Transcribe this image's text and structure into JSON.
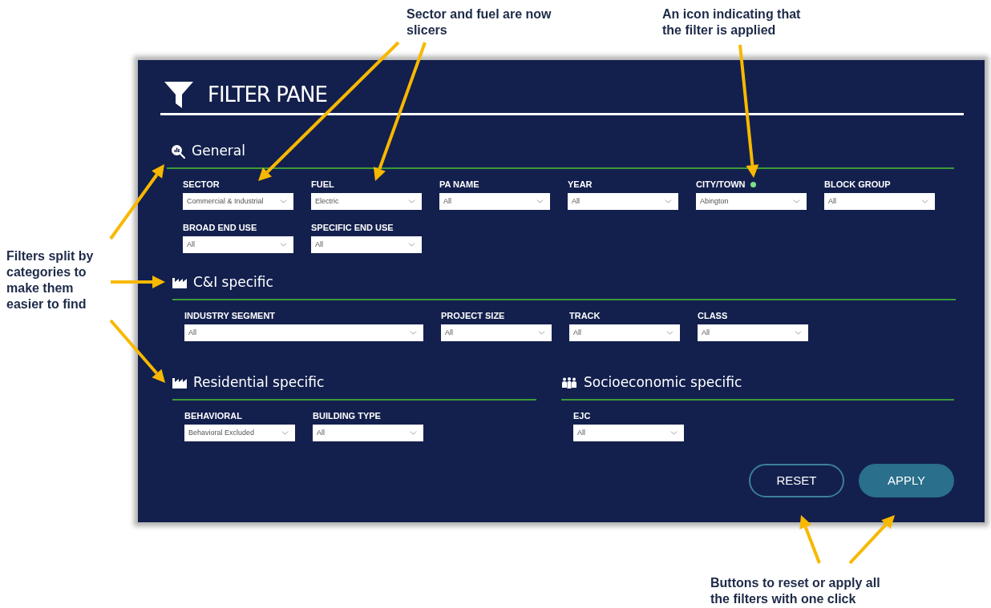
{
  "callouts": [
    {
      "text": "Sector and fuel are now slicers"
    },
    {
      "text": "An icon indicating that the filter is applied"
    },
    {
      "text": "Filters split by categories to make them easier to find"
    },
    {
      "text": "Buttons to reset or apply all the filters with one click"
    }
  ],
  "pane": {
    "title": "FILTER PANE",
    "sections": [
      {
        "title": "General",
        "filters": [
          {
            "label": "SECTOR",
            "value": "Commercial & Industrial",
            "applied": false,
            "wide": false
          },
          {
            "label": "FUEL",
            "value": "Electric",
            "applied": false,
            "wide": false
          },
          {
            "label": "PA NAME",
            "value": "All",
            "applied": false,
            "wide": false
          },
          {
            "label": "YEAR",
            "value": "All",
            "applied": false,
            "wide": false
          },
          {
            "label": "CITY/TOWN",
            "value": "Abington",
            "applied": true,
            "wide": false
          },
          {
            "label": "BLOCK GROUP",
            "value": "All",
            "applied": false,
            "wide": false
          },
          {
            "label": "BROAD END USE",
            "value": "All",
            "applied": false,
            "wide": false
          },
          {
            "label": "SPECIFIC END USE",
            "value": "All",
            "applied": false,
            "wide": false
          }
        ]
      },
      {
        "title": "C&I specific",
        "filters": [
          {
            "label": "INDUSTRY SEGMENT",
            "value": "All",
            "applied": false,
            "wide": true
          },
          {
            "label": "PROJECT SIZE",
            "value": "All",
            "applied": false,
            "wide": false
          },
          {
            "label": "TRACK",
            "value": "All",
            "applied": false,
            "wide": false
          },
          {
            "label": "CLASS",
            "value": "All",
            "applied": false,
            "wide": false
          }
        ]
      },
      {
        "title": "Residential specific",
        "filters": [
          {
            "label": "BEHAVIORAL",
            "value": "Behavioral Excluded",
            "applied": false,
            "wide": false
          },
          {
            "label": "BUILDING TYPE",
            "value": "All",
            "applied": false,
            "wide": false
          }
        ]
      },
      {
        "title": "Socioeconomic specific",
        "filters": [
          {
            "label": "EJC",
            "value": "All",
            "applied": false,
            "wide": false
          }
        ]
      }
    ],
    "buttons": [
      {
        "label": "RESET",
        "kind": "outline"
      },
      {
        "label": "APPLY",
        "kind": "filled"
      }
    ]
  }
}
